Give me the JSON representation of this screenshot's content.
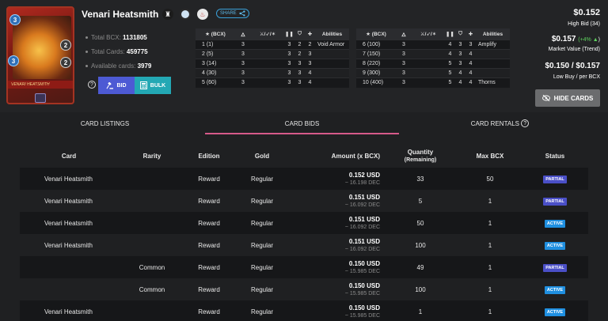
{
  "card": {
    "title": "Venari Heatsmith",
    "mana": "3",
    "attack": "2",
    "speed": "3",
    "health": "2",
    "banner_name": "VENARI HEATSMITH"
  },
  "header": {
    "share_label": "SHARE",
    "stats": [
      {
        "label": "Total BCX:",
        "value": "1131805"
      },
      {
        "label": "Total Cards:",
        "value": "459775"
      },
      {
        "label": "Available cards:",
        "value": "3979"
      }
    ],
    "bid_label": "BID",
    "bulk_label": "BULK"
  },
  "levels_headers": [
    "(BCX)",
    "",
    "",
    "",
    "",
    "",
    "Abilities"
  ],
  "levels_left": [
    [
      "1 (1)",
      "3",
      "3",
      "2",
      "2",
      "Void Armor"
    ],
    [
      "2 (5)",
      "3",
      "3",
      "2",
      "3",
      ""
    ],
    [
      "3 (14)",
      "3",
      "3",
      "3",
      "3",
      ""
    ],
    [
      "4 (30)",
      "3",
      "3",
      "3",
      "4",
      ""
    ],
    [
      "5 (60)",
      "3",
      "3",
      "3",
      "4",
      ""
    ]
  ],
  "levels_right": [
    [
      "6 (100)",
      "3",
      "4",
      "3",
      "3",
      "Amplify"
    ],
    [
      "7 (150)",
      "3",
      "4",
      "3",
      "4",
      ""
    ],
    [
      "8 (220)",
      "3",
      "5",
      "3",
      "4",
      ""
    ],
    [
      "9 (300)",
      "3",
      "5",
      "4",
      "4",
      ""
    ],
    [
      "10 (400)",
      "3",
      "5",
      "4",
      "4",
      "Thorns"
    ]
  ],
  "market": {
    "high_bid": "$0.152",
    "high_bid_label": "High Bid (34)",
    "market_value": "$0.157",
    "market_trend": "(+4%",
    "market_trend_close": ")",
    "market_value_label": "Market Value (Trend)",
    "low_buy": "$0.150 / $0.157",
    "low_buy_label": "Low Buy / per BCX",
    "hide_cards_label": "HIDE CARDS"
  },
  "tabs": [
    {
      "label": "CARD LISTINGS"
    },
    {
      "label": "CARD BIDS"
    },
    {
      "label": "CARD RENTALS"
    }
  ],
  "bids": {
    "headers": [
      "Card",
      "Rarity",
      "Edition",
      "Gold",
      "Amount (x BCX)",
      "Quantity",
      "(Remaining)",
      "Max BCX",
      "Status"
    ],
    "rows": [
      {
        "card": "Venari Heatsmith",
        "rarity": "",
        "edition": "Reward",
        "gold": "Regular",
        "usd": "0.152 USD",
        "dec": "~ 16.198 DEC",
        "qty": "33",
        "max": "50",
        "status": "PARTIAL"
      },
      {
        "card": "Venari Heatsmith",
        "rarity": "",
        "edition": "Reward",
        "gold": "Regular",
        "usd": "0.151 USD",
        "dec": "~ 16.092 DEC",
        "qty": "5",
        "max": "1",
        "status": "PARTIAL"
      },
      {
        "card": "Venari Heatsmith",
        "rarity": "",
        "edition": "Reward",
        "gold": "Regular",
        "usd": "0.151 USD",
        "dec": "~ 16.092 DEC",
        "qty": "50",
        "max": "1",
        "status": "ACTIVE"
      },
      {
        "card": "Venari Heatsmith",
        "rarity": "",
        "edition": "Reward",
        "gold": "Regular",
        "usd": "0.151 USD",
        "dec": "~ 16.092 DEC",
        "qty": "100",
        "max": "1",
        "status": "ACTIVE"
      },
      {
        "card": "",
        "rarity": "Common",
        "edition": "Reward",
        "gold": "Regular",
        "usd": "0.150 USD",
        "dec": "~ 15.985 DEC",
        "qty": "49",
        "max": "1",
        "status": "PARTIAL"
      },
      {
        "card": "",
        "rarity": "Common",
        "edition": "Reward",
        "gold": "Regular",
        "usd": "0.150 USD",
        "dec": "~ 15.985 DEC",
        "qty": "100",
        "max": "1",
        "status": "ACTIVE"
      },
      {
        "card": "Venari Heatsmith",
        "rarity": "",
        "edition": "Reward",
        "gold": "Regular",
        "usd": "0.150 USD",
        "dec": "~ 15.985 DEC",
        "qty": "1",
        "max": "1",
        "status": "ACTIVE"
      }
    ]
  },
  "colors": {
    "partial": "#4a4fc7",
    "active": "#1f8fe0",
    "bid_button": "#4d5ad4",
    "bulk_button": "#23a8b4",
    "tab_active_underline": "#d65a8a",
    "trend_up": "#5fd35f"
  }
}
